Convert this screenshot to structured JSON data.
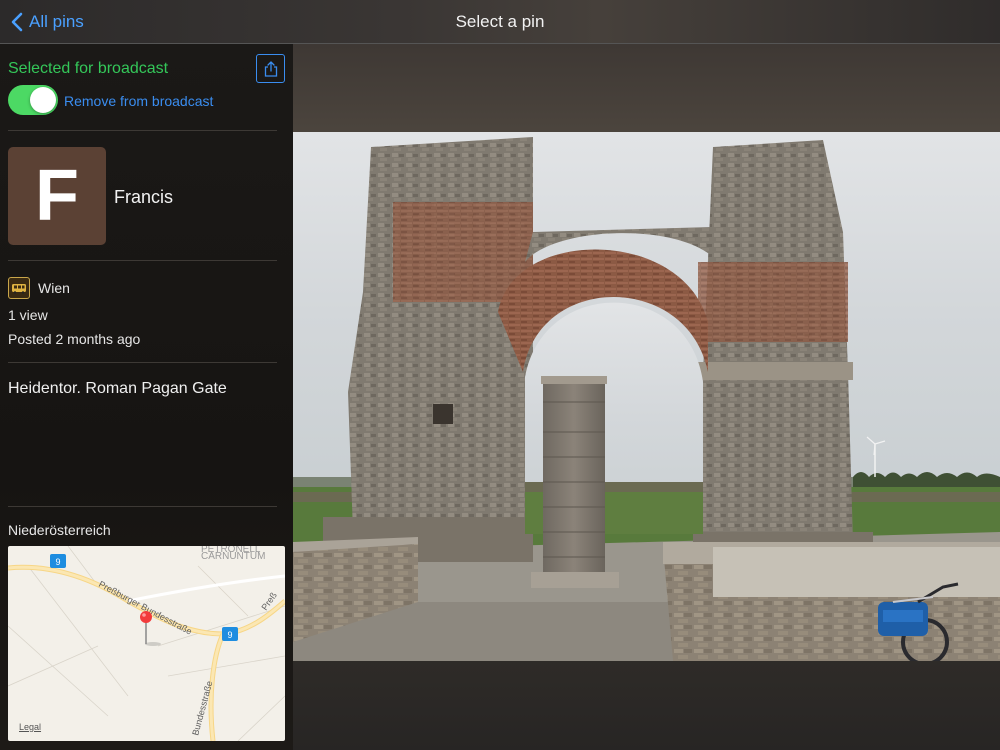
{
  "nav": {
    "back_label": "All pins",
    "title": "Select a pin"
  },
  "broadcast": {
    "status": "Selected for broadcast",
    "toggle_on": true,
    "remove_label": "Remove from broadcast"
  },
  "user": {
    "initial": "F",
    "name": "Francis",
    "avatar_color": "#5b4134"
  },
  "pin": {
    "location": "Wien",
    "views": "1 view",
    "posted": "Posted 2 months ago",
    "description": "Heidentor. Roman Pagan Gate",
    "region": "Niederösterreich"
  },
  "map": {
    "place_label": "CARNUNTUM",
    "place_label_partial": "PETRONELL",
    "street_main": "Preßburger Bundesstraße",
    "street_south": "Bundesstraße",
    "street_east": "Preß",
    "route_number": "9",
    "legal": "Legal"
  },
  "colors": {
    "accent_blue": "#3a8df0",
    "toggle_green": "#4cd964",
    "status_green": "#34c759"
  },
  "icons": {
    "back": "chevron-left-icon",
    "share": "share-icon",
    "location": "bus-icon",
    "map_pin": "map-pin-icon"
  }
}
